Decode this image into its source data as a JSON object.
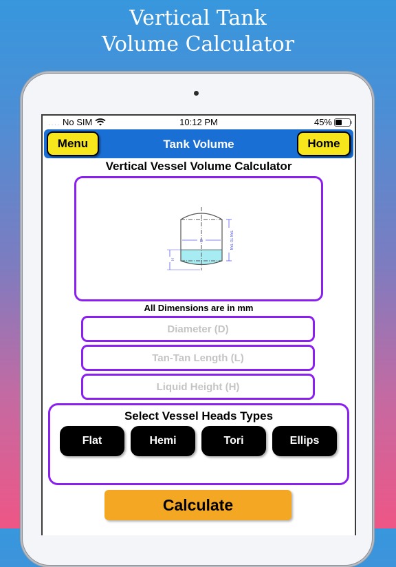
{
  "promo": {
    "title_line1": "Vertical Tank",
    "title_line2": "Volume Calculator"
  },
  "status_bar": {
    "signal_dots": "․․․․",
    "carrier": "No SIM",
    "time": "10:12 PM",
    "battery_text": "45%",
    "battery_level": 0.45
  },
  "navbar": {
    "menu_label": "Menu",
    "title": "Tank Volume",
    "home_label": "Home"
  },
  "main": {
    "heading": "Vertical Vessel Volume Calculator",
    "diagram": {
      "diameter_label": "D",
      "height_label": "H",
      "tan_label": "TAN TO TAN"
    },
    "units_note": "All Dimensions are in mm",
    "inputs": [
      {
        "placeholder": "Diameter (D)",
        "value": ""
      },
      {
        "placeholder": "Tan-Tan Length (L)",
        "value": ""
      },
      {
        "placeholder": "Liquid Height (H)",
        "value": ""
      }
    ],
    "heads": {
      "title": "Select Vessel Heads Types",
      "options": [
        "Flat",
        "Hemi",
        "Tori",
        "Ellips"
      ]
    },
    "calculate_label": "Calculate"
  },
  "colors": {
    "accent_purple": "#8a1ff0",
    "navbar_blue": "#1a6fd4",
    "nav_button_yellow": "#f7e61c",
    "calculate_orange": "#f4a723",
    "liquid_cyan": "#a6ecf2",
    "dimension_blue": "#5a5cf0"
  }
}
